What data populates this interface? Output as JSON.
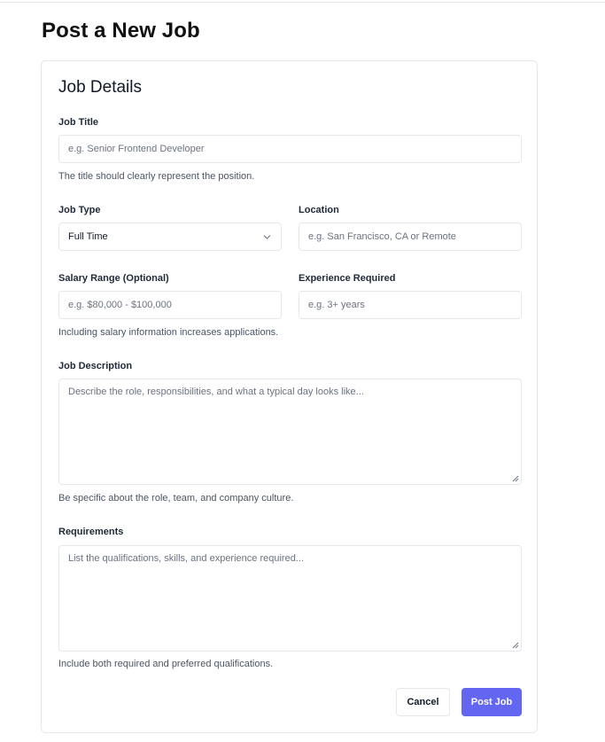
{
  "page": {
    "title": "Post a New Job"
  },
  "form": {
    "section_title": "Job Details",
    "job_title": {
      "label": "Job Title",
      "placeholder": "e.g. Senior Frontend Developer",
      "help": "The title should clearly represent the position."
    },
    "job_type": {
      "label": "Job Type",
      "selected": "Full Time"
    },
    "location": {
      "label": "Location",
      "placeholder": "e.g. San Francisco, CA or Remote"
    },
    "salary": {
      "label": "Salary Range (Optional)",
      "placeholder": "e.g. $80,000 - $100,000",
      "help": "Including salary information increases applications."
    },
    "experience": {
      "label": "Experience Required",
      "placeholder": "e.g. 3+ years"
    },
    "description": {
      "label": "Job Description",
      "placeholder": "Describe the role, responsibilities, and what a typical day looks like...",
      "help": "Be specific about the role, team, and company culture."
    },
    "requirements": {
      "label": "Requirements",
      "placeholder": "List the qualifications, skills, and experience required...",
      "help": "Include both required and preferred qualifications."
    },
    "actions": {
      "cancel_label": "Cancel",
      "submit_label": "Post Job"
    }
  },
  "colors": {
    "accent": "#6366f1",
    "border": "#e5e7eb",
    "help_text": "#4b5563"
  },
  "icons": {
    "select_arrow": "chevron-down-icon",
    "textarea_resize": "resize-handle-icon"
  }
}
